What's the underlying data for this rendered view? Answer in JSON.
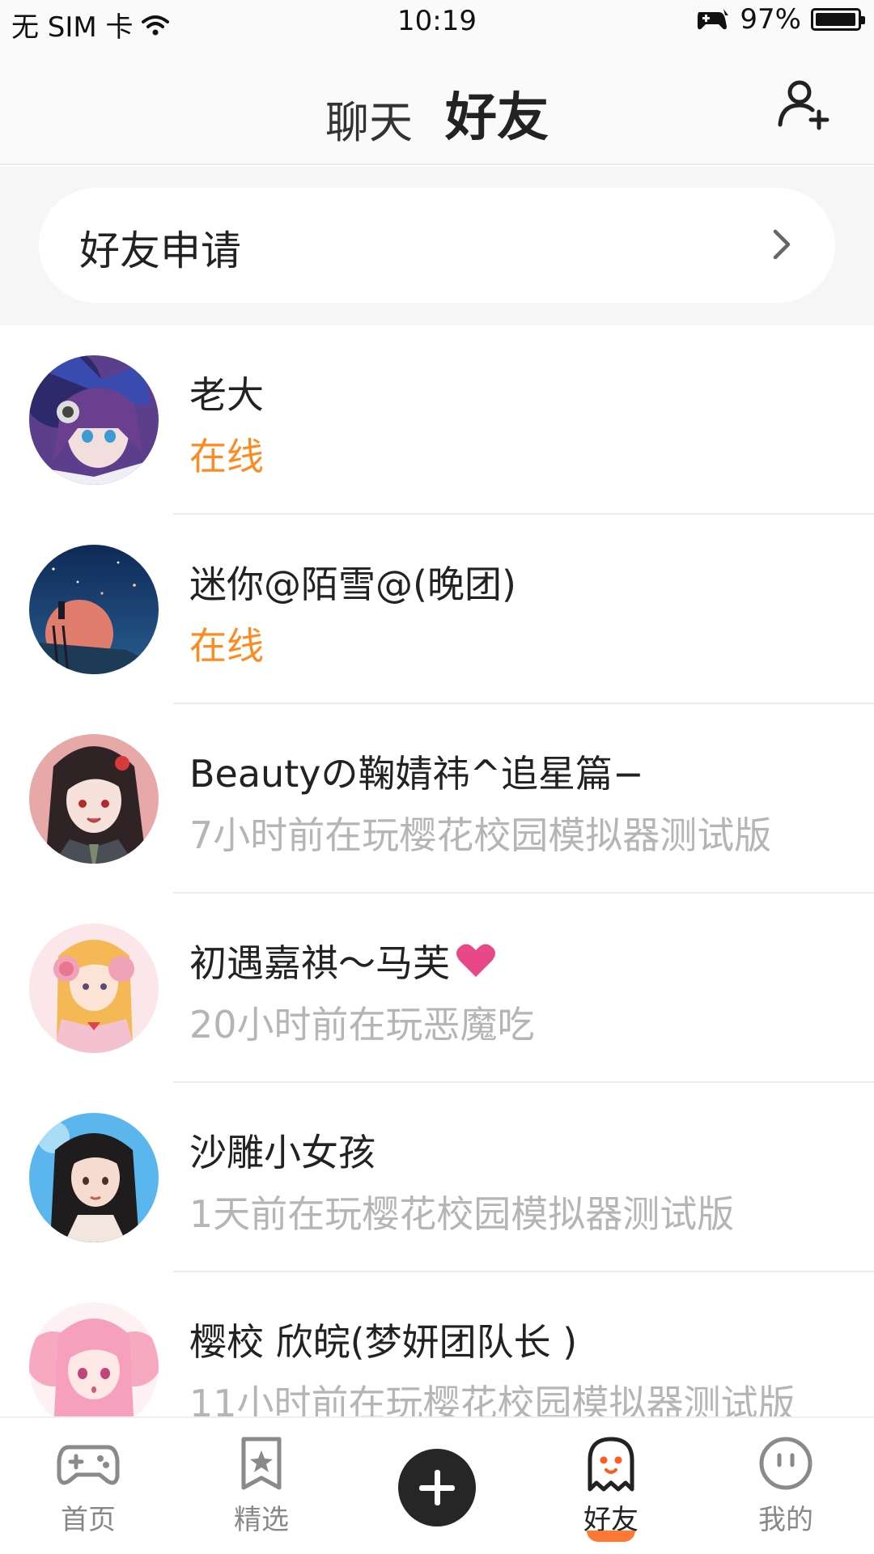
{
  "status_bar": {
    "carrier": "无 SIM 卡",
    "time": "10:19",
    "battery": "97%",
    "battery_level": 0.97
  },
  "header": {
    "tabs": [
      {
        "label": "聊天",
        "active": false
      },
      {
        "label": "好友",
        "active": true
      }
    ],
    "accent_color": "#ff5a1f"
  },
  "friend_request": {
    "label": "好友申请"
  },
  "friends": [
    {
      "name": "老大",
      "status": "在线",
      "online": true,
      "avatar": "avatar-purple-anime"
    },
    {
      "name": "迷你@陌雪@(晚团)",
      "status": "在线",
      "online": true,
      "avatar": "avatar-night-sky"
    },
    {
      "name": "Beautyの鞠婧祎^追星篇−",
      "status": "7小时前在玩樱花校园模拟器测试版",
      "online": false,
      "avatar": "avatar-pink-girl"
    },
    {
      "name": "初遇嘉祺〜马芙",
      "status": "20小时前在玩恶魔吃",
      "online": false,
      "avatar": "avatar-headphone-girl",
      "suffix_icon": "heart-icon"
    },
    {
      "name": "沙雕小女孩",
      "status": "1天前在玩樱花校园模拟器测试版",
      "online": false,
      "avatar": "avatar-blue-sky-girl"
    },
    {
      "name": "樱校 欣皖(梦妍团队长 )",
      "status": "11小时前在玩樱花校园模拟器测试版",
      "online": false,
      "avatar": "avatar-pink-hair-girl"
    }
  ],
  "colors": {
    "online": "#ff8a1f",
    "offline": "#b5b5b5",
    "heart": "#e8488a"
  },
  "bottom_nav": {
    "items": [
      {
        "label": "首页",
        "icon": "gamepad-icon",
        "active": false
      },
      {
        "label": "精选",
        "icon": "star-bookmark-icon",
        "active": false
      },
      {
        "label": "",
        "icon": "plus-icon",
        "active": false
      },
      {
        "label": "好友",
        "icon": "ghost-icon",
        "active": true
      },
      {
        "label": "我的",
        "icon": "face-icon",
        "active": false
      }
    ]
  }
}
